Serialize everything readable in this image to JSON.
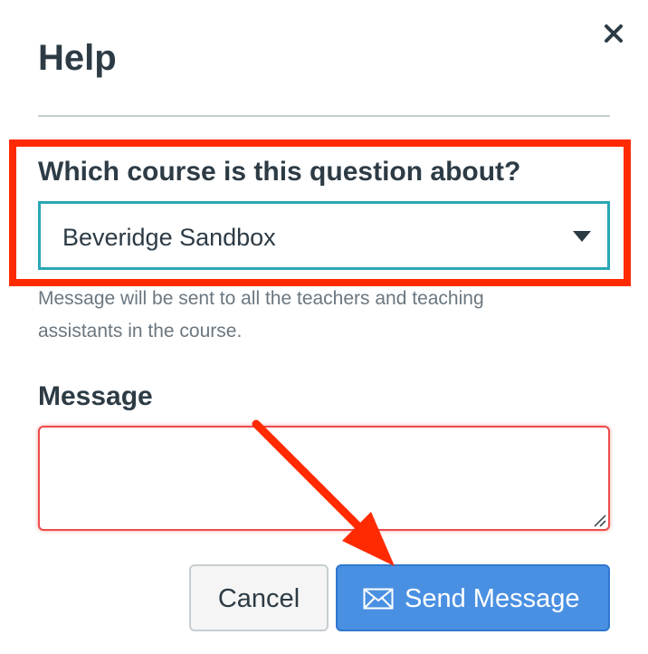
{
  "dialog": {
    "title": "Help",
    "close_icon": "close-icon"
  },
  "course": {
    "label": "Which course is this question about?",
    "selected": "Beveridge Sandbox",
    "hint": "Message will be sent to all the teachers and teaching assistants in the course."
  },
  "message": {
    "label": "Message",
    "value": ""
  },
  "actions": {
    "cancel_label": "Cancel",
    "send_label": "Send Message",
    "send_icon": "envelope-icon"
  },
  "annotations": {
    "highlight_color": "#ff2a00",
    "arrow_color": "#ff2a00"
  },
  "colors": {
    "primary_button": "#4a90e2",
    "select_border": "#2aa6b5",
    "textarea_error_border": "#ee4b4b",
    "text": "#2d3b45"
  }
}
